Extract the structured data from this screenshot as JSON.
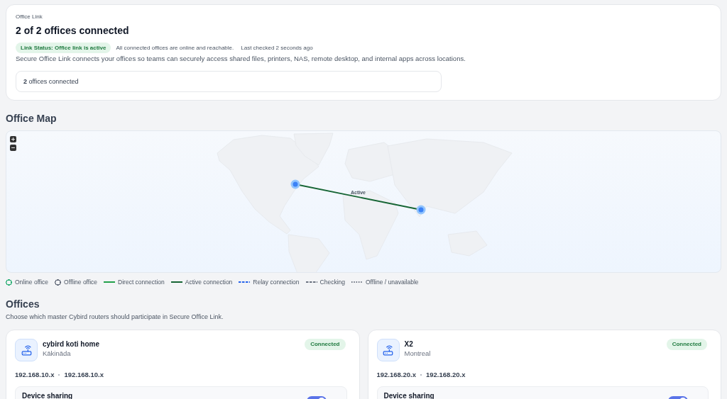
{
  "header": {
    "eyebrow": "Office Link",
    "title": "2 of 2 offices connected",
    "status_badge": "Link Status: Office link is active",
    "status_note": "All connected offices are online and reachable.",
    "last_checked": "Last checked 2 seconds ago",
    "description": "Secure Office Link connects your offices so teams can securely access shared files, printers, NAS, remote desktop, and internal apps across locations.",
    "summary": "**2** offices connected"
  },
  "map": {
    "title": "Office Map",
    "connections": [
      {
        "label": "Active",
        "kind": "active"
      }
    ],
    "legend": [
      {
        "label": "Online office",
        "kind": "circle",
        "color": "#34b27b"
      },
      {
        "label": "Offline office",
        "kind": "circle",
        "color": "#6b7280"
      },
      {
        "label": "Direct connection",
        "kind": "solid",
        "color": "#22a04b"
      },
      {
        "label": "Active connection",
        "kind": "solid",
        "color": "#166534"
      },
      {
        "label": "Relay connection",
        "kind": "dashed",
        "color": "#2563eb"
      },
      {
        "label": "Checking",
        "kind": "dashed",
        "color": "#6b7280"
      },
      {
        "label": "Offline / unavailable",
        "kind": "dotted",
        "color": "#6b7280"
      }
    ]
  },
  "offices_section": {
    "title": "Offices",
    "description": "Choose which master Cybird routers should participate in Secure Office Link."
  },
  "offices": [
    {
      "name": "cybird koti home",
      "location": "Kākināda",
      "status": "Connected",
      "ips": [
        "192.168.10.x",
        "192.168.10.x"
      ],
      "sharing": {
        "title": "Device sharing",
        "on": true
      }
    },
    {
      "name": "X2",
      "location": "Montreal",
      "status": "Connected",
      "ips": [
        "192.168.20.x",
        "192.168.20.x"
      ],
      "sharing": {
        "title": "Device sharing",
        "on": true
      }
    }
  ]
}
